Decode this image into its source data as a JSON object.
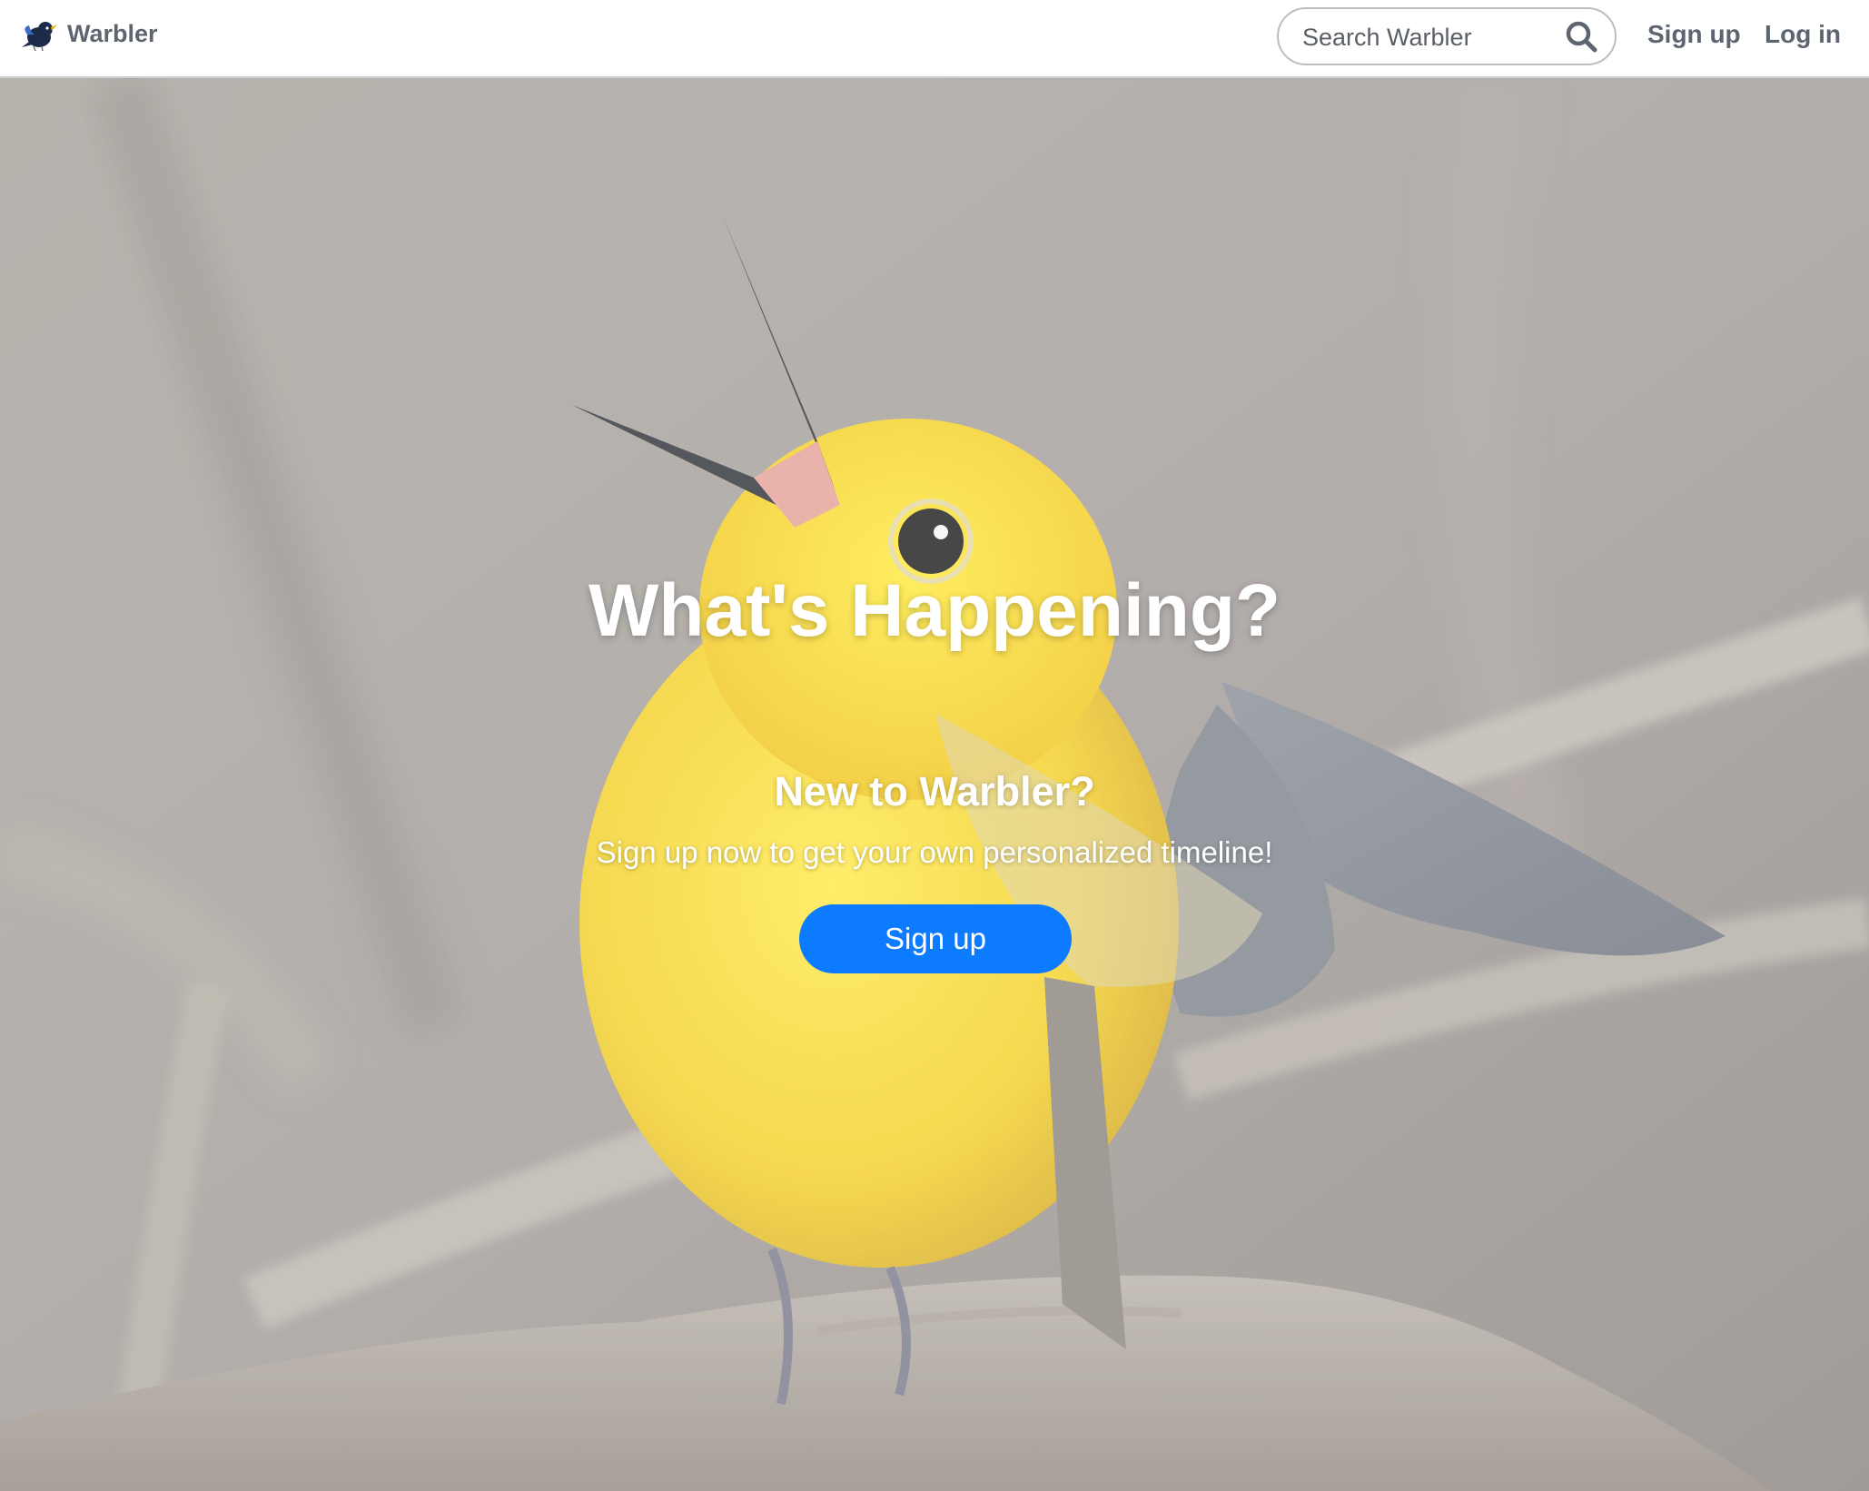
{
  "navbar": {
    "brand_name": "Warbler",
    "search": {
      "placeholder": "Search Warbler",
      "value": ""
    },
    "signup_label": "Sign up",
    "login_label": "Log in"
  },
  "hero": {
    "headline": "What's Happening?",
    "subhead": "New to Warbler?",
    "tagline": "Sign up now to get your own personalized timeline!",
    "cta_label": "Sign up"
  },
  "colors": {
    "accent": "#0d7bff",
    "nav_text": "#5d6670",
    "hero_text": "#ffffff",
    "bird_yellow": "#f4d52c"
  },
  "icons": [
    "warbler-logo-icon",
    "search-icon"
  ]
}
